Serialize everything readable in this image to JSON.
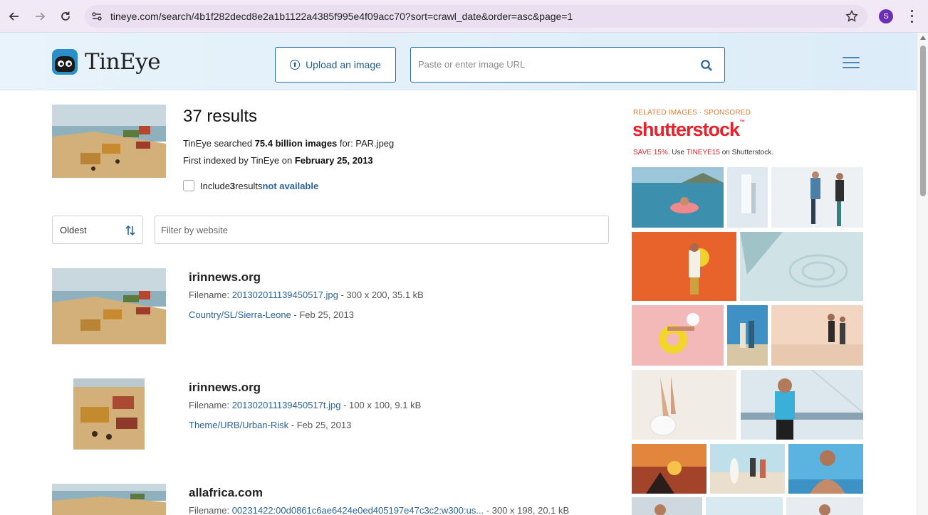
{
  "browser": {
    "url": "tineye.com/search/4b1f282decd8e2a1b1122a4385f995e4f09acc70?sort=crawl_date&order=asc&page=1",
    "profile_initial": "S"
  },
  "site": {
    "logo_text": "TinEye",
    "upload_label": "Upload an image",
    "url_placeholder": "Paste or enter image URL"
  },
  "summary": {
    "count": "37 results",
    "searched_prefix": "TinEye searched ",
    "searched_bold": "75.4 billion images",
    "searched_suffix": " for: PAR.jpeg",
    "indexed_prefix": "First indexed by TinEye on ",
    "indexed_date": "February 25, 2013",
    "include_prefix": "Include ",
    "include_count": "3",
    "include_middle": " results ",
    "include_link": "not available"
  },
  "controls": {
    "sort_value": "Oldest",
    "filter_placeholder": "Filter by website"
  },
  "results": [
    {
      "domain": "irinnews.org",
      "filename_label": "Filename: ",
      "filename": "201302011139450517.jpg",
      "dims": " - 300 x 200, 35.1 kB",
      "path": "Country/SL/Sierra-Leone",
      "date": " - Feb 25, 2013"
    },
    {
      "domain": "irinnews.org",
      "filename_label": "Filename: ",
      "filename": "201302011139450517t.jpg",
      "dims": " - 100 x 100, 9.1 kB",
      "path": "Theme/URB/Urban-Risk",
      "date": " - Feb 25, 2013"
    },
    {
      "domain": "allafrica.com",
      "filename_label": "Filename: ",
      "filename": "00231422:00d0861c6ae6424e0ed405197e47c3c2:w300:us...",
      "dims": " - 300 x 198, 20.1 kB"
    }
  ],
  "sidebar": {
    "sponsored_label": "RELATED IMAGES · SPONSORED",
    "brand_name": "shutterstock",
    "promo_save": "SAVE 15%.",
    "promo_use": " Use ",
    "promo_code": "TINEYE15",
    "promo_suffix": " on Shutterstock."
  },
  "colors": {
    "accent": "#2a6496",
    "brand_red": "#e8212b",
    "sponsored_orange": "#e07b39"
  }
}
